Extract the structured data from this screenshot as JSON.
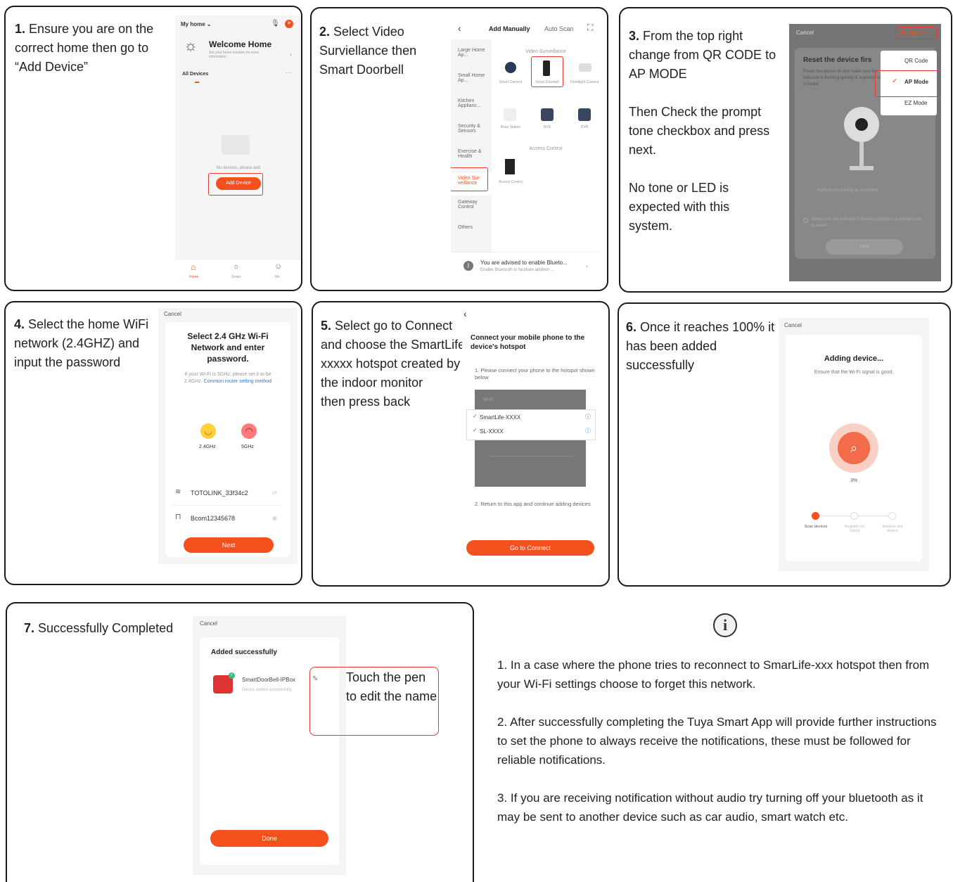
{
  "panels": {
    "p1": {
      "num": "1.",
      "text": " Ensure you are on the correct home then go to “Add Device”",
      "home_label": "My home ⌄",
      "welcome": "Welcome Home",
      "welcome_sub": "Set your home location for more information",
      "all_devices": "All Devices",
      "no_devices": "No devices, please add",
      "add_device": "Add Device",
      "tabs": [
        "Home",
        "Smart",
        "Me"
      ]
    },
    "p2": {
      "num": "2.",
      "text": " Select Video Surviellance then Smart Doorbell",
      "tab_manual": "Add Manually",
      "tab_auto": "Auto Scan",
      "categories": [
        "Large Home Ap...",
        "Small Home Ap...",
        "Kitchen Applianc...",
        "Security & Sensors",
        "Exercise & Health",
        "Video Sur-veillance",
        "Gateway Control",
        "Others"
      ],
      "section_video": "Video Surveillance",
      "devices_row1": [
        "Smart Camera",
        "Smart Doorbell",
        "Floodlight Camera"
      ],
      "devices_row2": [
        "Base Station",
        "NVR",
        "DVR"
      ],
      "section_access": "Access Control",
      "access_device": "Access Control",
      "bt_title": "You are advised to enable Blueto...",
      "bt_sub": "Enable Bluetooth to facilitate addition ..."
    },
    "p3": {
      "num": "3.",
      "text1": " From the top right change from QR CODE to AP MODE",
      "text2": "Then Check the prompt tone checkbox and press next.",
      "text3": "No tone or LED is expected with this system.",
      "cancel": "Cancel",
      "ap_mode": "AP Mode ⇋",
      "menu": [
        "QR Code",
        "AP Mode",
        "EZ Mode"
      ],
      "reset_title": "Reset the device firs",
      "reset_sub": "Power the device on and make sure the indicator is flashing quickly or a prompt tone is heard",
      "perform": "Perform net pairing as prompted ›",
      "make_sure": "Make sure the indicator is flashing quickly or a prompt tone is heard",
      "next": "Next"
    },
    "p4": {
      "num": "4.",
      "text": " Select the home WiFi network (2.4GHZ) and input the password",
      "cancel": "Cancel",
      "title": "Select 2.4 GHz Wi-Fi Network and enter password.",
      "note": "If your Wi-Fi is 5GHz, please set it to be 2.4GHz.",
      "link": "Common router setting method",
      "band1": "2.4GHz",
      "band2": "5GHz",
      "ssid": "TOTOLINK_33f34c2",
      "password": "Bcom12345678",
      "next": "Next"
    },
    "p5": {
      "num": "5.",
      "text": " Select go to Connect and choose the SmartLife-xxxxx hotspot created by the indoor monitor\nthen press back",
      "title": "Connect your mobile phone to the device's hotspot",
      "step1": "1. Please connect your phone to the hotspot shown below",
      "wifi_header": "Wi-Fi",
      "networks": [
        "SmartLife-XXXX",
        "SL-XXXX"
      ],
      "step2": "2. Return to this app and continue adding devices",
      "button": "Go to Connect"
    },
    "p6": {
      "num": "6.",
      "text": " Once it reaches 100% it has been added successfully",
      "cancel": "Cancel",
      "title": "Adding device...",
      "sub": "Ensure that the Wi-Fi signal is good.",
      "percent": "3%",
      "steps": [
        "Scan devices",
        "Register on Cloud",
        "Initialize the device"
      ]
    },
    "p7": {
      "num": "7.",
      "text": " Successfully Completed",
      "cancel": "Cancel",
      "title": "Added successfully",
      "device": "SmartDoorBell-IPBox",
      "device_sub": "Device added successfully",
      "callout": "Touch the pen to edit the name",
      "done": "Done"
    }
  },
  "info": {
    "icon": "info-icon",
    "tips": [
      "1. In a case where the phone tries to reconnect to SmarLife-xxx hotspot then from your Wi-Fi settings choose to forget this network.",
      "2. After successfully completing the Tuya Smart App will provide further instructions to set the phone to always receive the notifications, these must be followed for reliable notifications.",
      "3. If you are receiving notification without audio try turning off your bluetooth as it may be sent to another device such as car audio, smart watch etc."
    ]
  },
  "colors": {
    "accent": "#f4511e",
    "highlight": "#e53935"
  }
}
